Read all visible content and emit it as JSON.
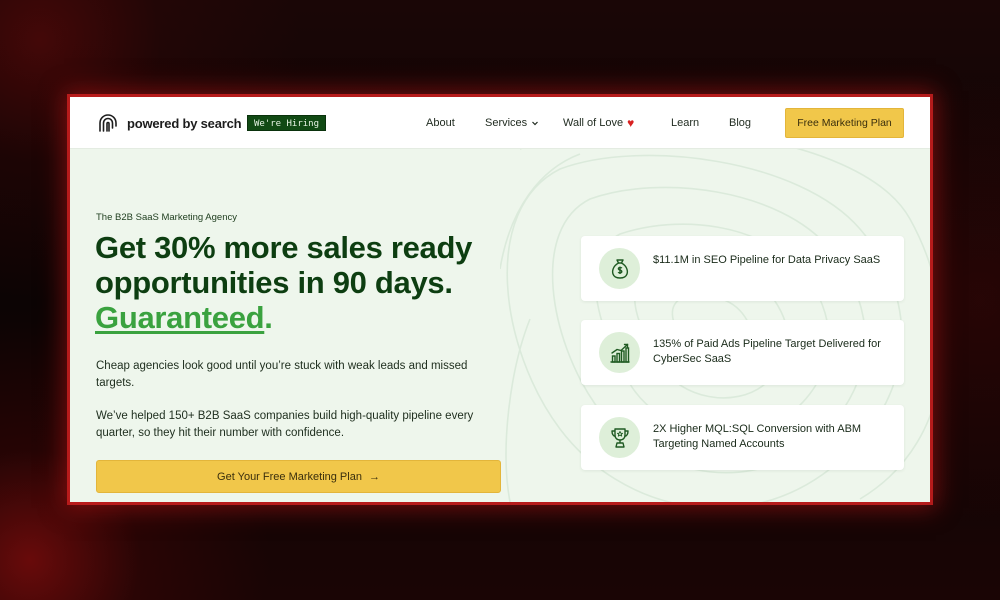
{
  "brand": {
    "name": "powered by search",
    "hiring_badge": "We're Hiring"
  },
  "nav": {
    "items": [
      {
        "label": "About"
      },
      {
        "label": "Services"
      },
      {
        "label": "Wall of Love"
      },
      {
        "label": "Learn"
      },
      {
        "label": "Blog"
      }
    ],
    "cta_label": "Free Marketing Plan"
  },
  "hero": {
    "eyebrow": "The B2B SaaS Marketing Agency",
    "headline_line1": "Get 30% more sales ready",
    "headline_line2": "opportunities in 90 days.",
    "headline_accent": "Guaranteed",
    "headline_dot": ".",
    "paragraph1": "Cheap agencies look good until you’re stuck with weak leads and missed targets.",
    "paragraph2": "We’ve helped 150+ B2B SaaS companies build high-quality pipeline every quarter, so they hit their number with confidence.",
    "cta_label": "Get Your Free Marketing Plan",
    "cta_arrow": "→"
  },
  "stats": [
    {
      "icon": "money-bag-icon",
      "text": "$11.1M in SEO Pipeline for Data Privacy SaaS"
    },
    {
      "icon": "bar-chart-growth-icon",
      "text": "135% of Paid Ads Pipeline Target Delivered for CyberSec SaaS"
    },
    {
      "icon": "trophy-icon",
      "text": "2X Higher MQL:SQL Conversion with ABM Targeting Named Accounts"
    }
  ],
  "colors": {
    "page_bg": "#eef6ec",
    "headline": "#0d3e11",
    "accent_green": "#3aa23f",
    "cta_yellow": "#f1c74a",
    "hiring_badge_bg": "#114a14",
    "heart": "#d82121",
    "frame_glow": "#c81e1e"
  }
}
